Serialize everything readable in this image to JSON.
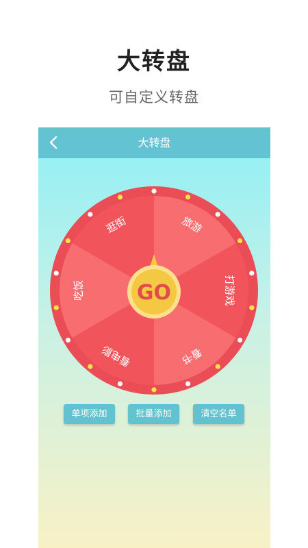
{
  "header": {
    "title": "大转盘",
    "subtitle": "可自定义转盘"
  },
  "app": {
    "title": "大转盘",
    "back_icon": "chevron-left-icon"
  },
  "wheel": {
    "center_label": "GO",
    "segments": [
      {
        "label": "逛街",
        "color": "#f1545b"
      },
      {
        "label": "旅游",
        "color": "#f76d70"
      },
      {
        "label": "打游戏",
        "color": "#f1545b"
      },
      {
        "label": "看书",
        "color": "#f76d70"
      },
      {
        "label": "看电影",
        "color": "#f1545b"
      },
      {
        "label": "吃饭",
        "color": "#f76d70"
      }
    ],
    "rim_color": "#ea4d55",
    "center_color": "#f5c843"
  },
  "actions": {
    "add_single": "单项添加",
    "add_batch": "批量添加",
    "clear_list": "清空名单"
  }
}
